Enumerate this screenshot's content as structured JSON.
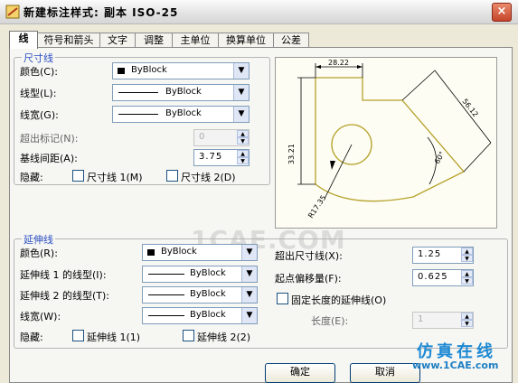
{
  "window": {
    "title": "新建标注样式: 副本 ISO-25",
    "close_glyph": "×"
  },
  "tabs": [
    "线",
    "符号和箭头",
    "文字",
    "调整",
    "主单位",
    "换算单位",
    "公差"
  ],
  "dim_lines": {
    "group_title": "尺寸线",
    "color_label": "颜色(C):",
    "color_value": "ByBlock",
    "linetype_label": "线型(L):",
    "linetype_value": "ByBlock",
    "lineweight_label": "线宽(G):",
    "lineweight_value": "ByBlock",
    "extend_ticks_label": "超出标记(N):",
    "extend_ticks_value": "0",
    "baseline_spacing_label": "基线间距(A):",
    "baseline_spacing_value": "3.75",
    "suppress_label": "隐藏:",
    "suppress1_label": "尺寸线 1(M)",
    "suppress2_label": "尺寸线 2(D)"
  },
  "preview": {
    "dim_top": "28.22",
    "dim_left": "33.21",
    "dim_right": "56.12",
    "dim_radius": "R17.35",
    "dim_angle": "60°"
  },
  "watermark": "1CAE.COM",
  "ext_lines": {
    "group_title": "延伸线",
    "color_label": "颜色(R):",
    "color_value": "ByBlock",
    "linetype1_label": "延伸线 1 的线型(I):",
    "linetype1_value": "ByBlock",
    "linetype2_label": "延伸线 2 的线型(T):",
    "linetype2_value": "ByBlock",
    "lineweight_label": "线宽(W):",
    "lineweight_value": "ByBlock",
    "suppress_label": "隐藏:",
    "suppress1_label": "延伸线 1(1)",
    "suppress2_label": "延伸线 2(2)",
    "extend_beyond_label": "超出尺寸线(X):",
    "extend_beyond_value": "1.25",
    "offset_label": "起点偏移量(F):",
    "offset_value": "0.625",
    "fixed_length_label": "固定长度的延伸线(O)",
    "length_label": "长度(E):",
    "length_value": "1"
  },
  "buttons": {
    "ok": "确定",
    "cancel": "取消"
  },
  "brand": {
    "cn": "仿真在线",
    "url": "www.1CAE.com"
  }
}
